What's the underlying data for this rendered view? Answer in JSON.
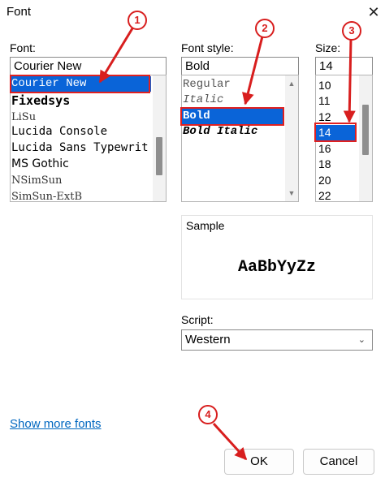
{
  "window": {
    "title": "Font"
  },
  "font": {
    "label": "Font:",
    "value": "Courier New",
    "items": [
      {
        "label": "Courier New",
        "selected": true
      },
      {
        "label": "Fixedsys"
      },
      {
        "label": "LiSu"
      },
      {
        "label": "Lucida Console"
      },
      {
        "label": "Lucida Sans Typewrit"
      },
      {
        "label": "MS Gothic"
      },
      {
        "label": "NSimSun"
      },
      {
        "label": "SimSun-ExtB"
      }
    ]
  },
  "style": {
    "label": "Font style:",
    "value": "Bold",
    "items": [
      {
        "label": "Regular"
      },
      {
        "label": "Italic"
      },
      {
        "label": "Bold",
        "selected": true
      },
      {
        "label": "Bold Italic"
      }
    ]
  },
  "size": {
    "label": "Size:",
    "value": "14",
    "items": [
      {
        "label": "10"
      },
      {
        "label": "11"
      },
      {
        "label": "12"
      },
      {
        "label": "14",
        "selected": true
      },
      {
        "label": "16"
      },
      {
        "label": "18"
      },
      {
        "label": "20"
      },
      {
        "label": "22"
      }
    ]
  },
  "sample": {
    "label": "Sample",
    "text": "AaBbYyZz"
  },
  "script": {
    "label": "Script:",
    "value": "Western"
  },
  "show_more_fonts": "Show more fonts",
  "buttons": {
    "ok": "OK",
    "cancel": "Cancel"
  },
  "callouts": [
    "1",
    "2",
    "3",
    "4"
  ],
  "colors": {
    "selection": "#0a64d8",
    "callout": "#d81e1e",
    "link": "#0067c0"
  },
  "icons": {
    "close": "close-icon",
    "scroll_up": "chevron-up-icon",
    "scroll_down": "chevron-down-icon",
    "dropdown": "chevron-down-icon"
  }
}
